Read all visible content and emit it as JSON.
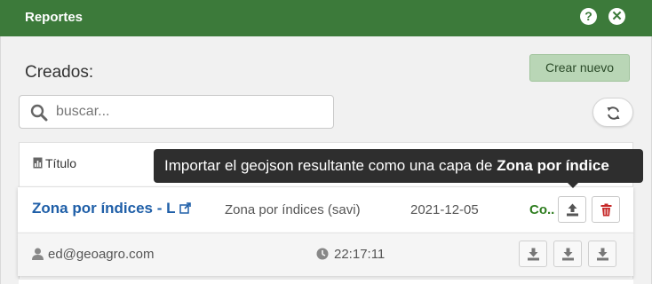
{
  "header": {
    "title": "Reportes",
    "help_icon": "question-circle-icon",
    "close_icon": "close-circle-icon"
  },
  "section": {
    "title": "Creados:",
    "new_button": "Crear nuevo"
  },
  "search": {
    "placeholder": "buscar...",
    "value": ""
  },
  "table": {
    "column_title": "Título"
  },
  "tooltip": {
    "text": "Importar el geojson resultante como una capa de ",
    "bold": "Zona por índice"
  },
  "report": {
    "name": "Zona por índices - L",
    "type": "Zona por índices (savi)",
    "date": "2021-12-05",
    "status": "Co...",
    "status_color": "#2e7d1f",
    "user": "ed@geoagro.com",
    "time": "22:17:11"
  },
  "colors": {
    "header_bg": "#3c7a3a",
    "link": "#1f5fa8",
    "delete": "#c62828"
  }
}
